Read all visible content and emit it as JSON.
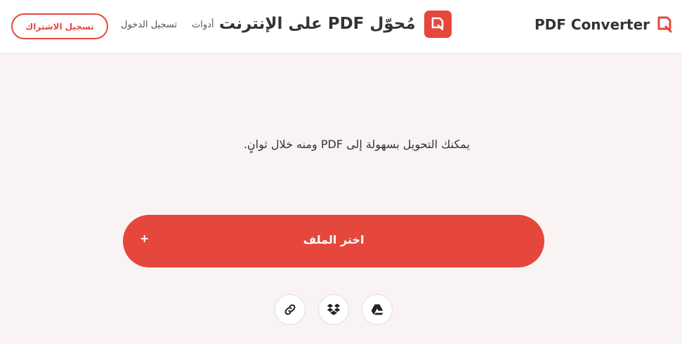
{
  "header": {
    "brand_name": "PDF Converter",
    "page_title": "مُحوّل PDF على الإنترنت",
    "nav": {
      "tools": "أدوات",
      "login": "تسجيل الدخول"
    },
    "signup_label": "تسجيل الاشتراك"
  },
  "main": {
    "tagline": "يمكنك التحويل بسهولة إلى PDF ومنه خلال ثوانٍ.",
    "choose_file_label": "اختر الملف",
    "plus_symbol": "+",
    "sources": [
      "link-icon",
      "dropbox-icon",
      "google-drive-icon"
    ]
  },
  "colors": {
    "accent": "#e5473c",
    "background": "#f9f4f3",
    "header_bg": "#ffffff",
    "text": "#333333"
  }
}
